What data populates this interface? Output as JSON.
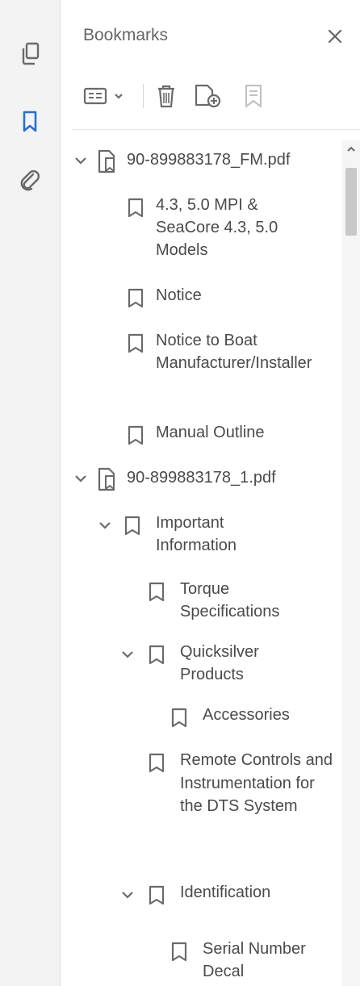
{
  "panel": {
    "title": "Bookmarks",
    "close_symbol": "×"
  },
  "rail": {
    "items": [
      {
        "icon": "pages-icon",
        "active": false
      },
      {
        "icon": "bookmark-icon",
        "active": true
      },
      {
        "icon": "attachment-icon",
        "active": false
      }
    ]
  },
  "toolbar": {
    "items": [
      "options-menu-icon",
      "delete-bookmark-icon",
      "new-bookmark-icon",
      "new-bookmark-from-structure-icon"
    ]
  },
  "tree": {
    "file1": {
      "name": "90-899883178_FM.pdf",
      "children": {
        "a": "4.3, 5.0 MPI & SeaCore 4.3, 5.0 Models",
        "b": "Notice",
        "c": "Notice to Boat Manufacturer/Installer",
        "d": "Manual Outline"
      }
    },
    "file2": {
      "name": "90-899883178_1.pdf",
      "important": "Important Information",
      "torque": "Torque Specifications",
      "quicksilver": "Quicksilver Products",
      "accessories": "Accessories",
      "remote": "Remote Controls and Instrumentation for the DTS System",
      "identification": "Identification",
      "serial": "Serial Number Decal"
    }
  },
  "colors": {
    "accent": "#2b6fd1",
    "icon": "#6a6a6a",
    "text": "#4a4a4a"
  }
}
